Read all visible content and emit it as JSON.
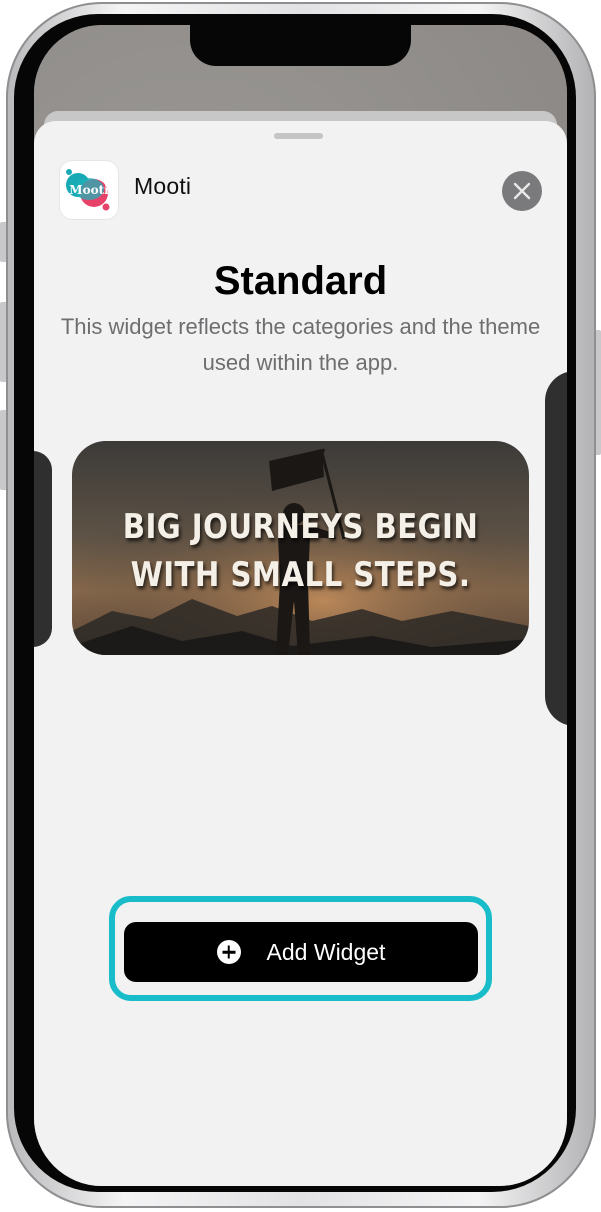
{
  "app": {
    "name": "Mooti",
    "logo_text": "Mooti"
  },
  "widget_gallery": {
    "title": "Standard",
    "description": "This widget reflects the categories and the theme used within the app.",
    "preview_quote": "BIG JOURNEYS BEGIN WITH SMALL STEPS."
  },
  "actions": {
    "add_widget_label": "Add Widget",
    "close_icon": "close-icon",
    "add_icon": "plus-circle-icon"
  },
  "colors": {
    "highlight": "#19bdc9",
    "button_bg": "#000000",
    "logo_teal": "#17a9b4",
    "logo_pink": "#e7426a"
  }
}
